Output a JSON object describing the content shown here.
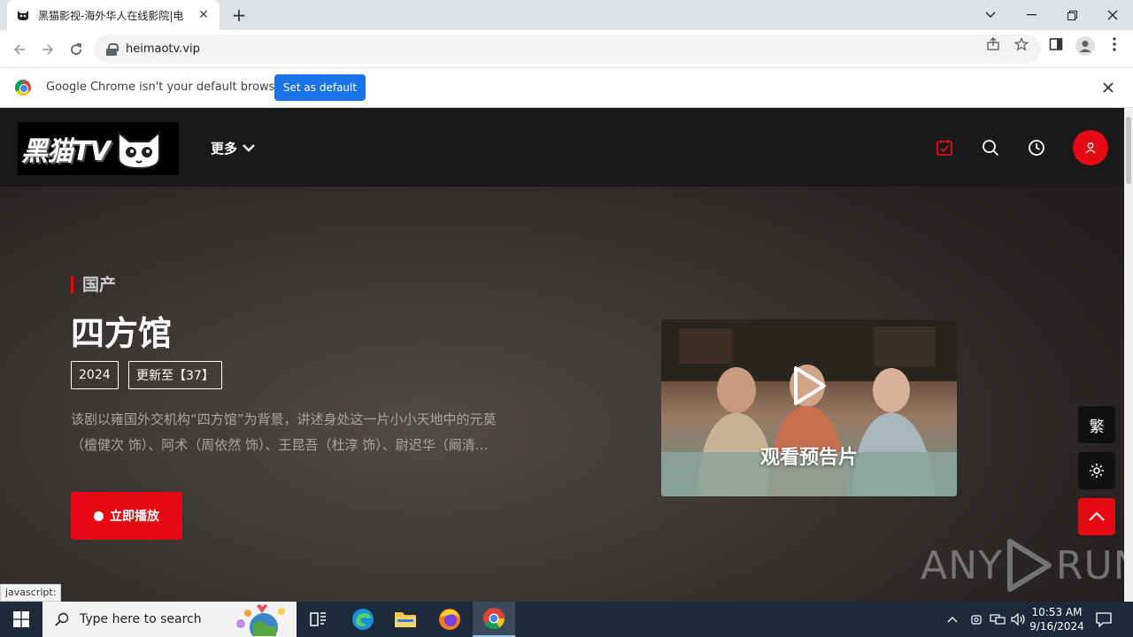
{
  "browser": {
    "tab_title": "黑猫影视-海外华人在线影院|电",
    "url": "heimaotv.vip",
    "infobar_text": "Google Chrome isn't your default browser",
    "set_default_label": "Set as default",
    "status_text": "javascript:"
  },
  "site": {
    "logo_text": "黑猫TV",
    "more_label": "更多",
    "icons": [
      "check-calendar-icon",
      "search-icon",
      "history-icon",
      "user-icon"
    ],
    "accent_color": "#e50914"
  },
  "hero": {
    "category": "国产",
    "title": "四方馆",
    "year": "2024",
    "update": "更新至【37】",
    "desc_line1": "该剧以雍国外交机构“四方馆”为背景，讲述身处这一片小小天地中的元莫",
    "desc_line2": "（檀健次 饰）、阿术（周依然 饰）、王昆吾（杜淳 饰）、尉迟华（阚清...",
    "play_label": "立即播放",
    "trailer_label": "观看预告片"
  },
  "side": {
    "traditional_label": "繁"
  },
  "watermark": {
    "left": "ANY",
    "right": "RUN"
  },
  "taskbar": {
    "search_placeholder": "Type here to search",
    "time": "10:53 AM",
    "date": "9/16/2024"
  }
}
